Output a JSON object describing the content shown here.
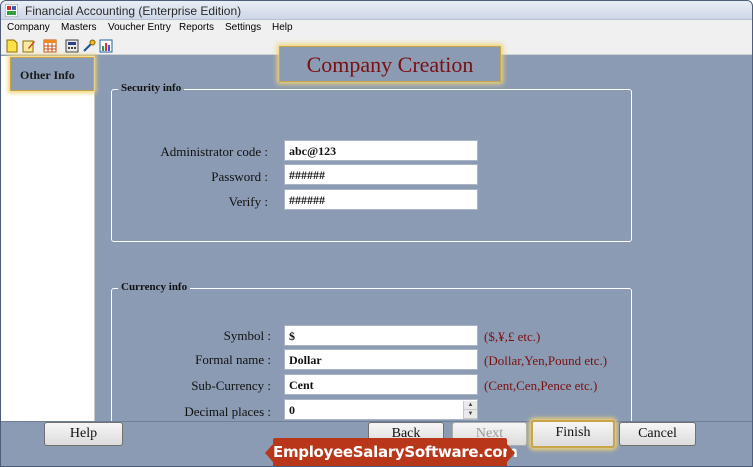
{
  "window": {
    "title": "Financial Accounting (Enterprise Edition)"
  },
  "menu": [
    "Company",
    "Masters",
    "Voucher Entry",
    "Reports",
    "Settings",
    "Help"
  ],
  "toolbar": {
    "icons": [
      "new-icon",
      "edit-icon",
      "table-icon",
      "calculator-icon",
      "tools-icon",
      "chart-icon"
    ]
  },
  "sidebar": {
    "tab_label": "Other Info"
  },
  "page": {
    "heading": "Company Creation"
  },
  "security": {
    "title": "Security info",
    "admin_label": "Administrator code :",
    "admin_value": "abc@123",
    "password_label": "Password :",
    "password_value": "######",
    "verify_label": "Verify :",
    "verify_value": "######"
  },
  "currency": {
    "title": "Currency info",
    "symbol_label": "Symbol :",
    "symbol_value": "$",
    "symbol_hint": "($,¥,£ etc.)",
    "formal_label": "Formal name :",
    "formal_value": "Dollar",
    "formal_hint": "(Dollar,Yen,Pound etc.)",
    "sub_label": "Sub-Currency :",
    "sub_value": "Cent",
    "sub_hint": "(Cent,Cen,Pence etc.)",
    "decimal_label": "Decimal places :",
    "decimal_value": "0"
  },
  "buttons": {
    "help": "Help",
    "back": "Back",
    "next": "Next",
    "finish": "Finish",
    "cancel": "Cancel"
  },
  "brand": {
    "text": "EmployeeSalarySoftware.com"
  },
  "colors": {
    "panel": "#8b9bb3",
    "accent_text": "#7a1010",
    "highlight": "#f2d575",
    "brand_bg": "#b8361a"
  }
}
